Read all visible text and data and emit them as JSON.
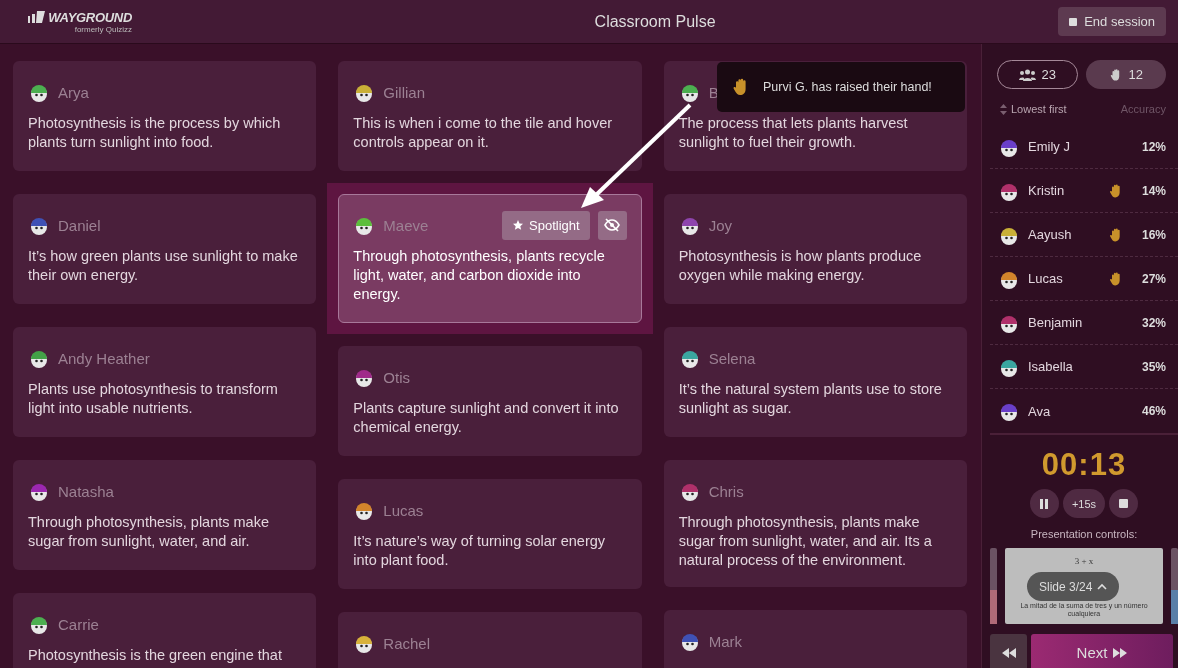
{
  "header": {
    "logo": "WAYGROUND",
    "logo_sub": "formerly Quizizz",
    "title": "Classroom Pulse",
    "end_button": "End session"
  },
  "columns": [
    [
      {
        "name": "Arya",
        "color": "#4caf50",
        "text": "Photosynthesis is the process by which plants turn sunlight into food.",
        "highlighted": false
      },
      {
        "name": "Daniel",
        "color": "#3f51b5",
        "text": "It’s how green plants use sunlight to make their own energy.",
        "highlighted": false
      },
      {
        "name": "Andy Heather",
        "color": "#43a047",
        "text": "Plants use photosynthesis to transform light into usable nutrients.",
        "highlighted": false
      },
      {
        "name": "Natasha",
        "color": "#9c27b0",
        "text": "Through photosynthesis, plants make sugar from sunlight, water, and air.",
        "highlighted": false
      },
      {
        "name": "Carrie",
        "color": "#4caf50",
        "text": "Photosynthesis is the green engine that",
        "highlighted": false
      }
    ],
    [
      {
        "name": "Gillian",
        "color": "#c9b037",
        "text": "This is when i come to the tile and hover controls appear on it.",
        "highlighted": false
      },
      {
        "name": "Maeve",
        "color": "#5cbf3c",
        "text": "Through photosynthesis, plants recycle light, water, and carbon dioxide into energy.",
        "highlighted": true,
        "action": "Spotlight"
      },
      {
        "name": "Otis",
        "color": "#a02a8a",
        "text": "Plants capture sunlight and convert it into chemical energy.",
        "highlighted": false
      },
      {
        "name": "Lucas",
        "color": "#d2842b",
        "text": "It’s nature’s way of turning solar energy into plant food.",
        "highlighted": false
      },
      {
        "name": "Rachel",
        "color": "#d8b23a",
        "text": "",
        "highlighted": false
      }
    ],
    [
      {
        "name": "B",
        "color": "#4caf50",
        "text": "The process that lets plants harvest sunlight to fuel their growth.",
        "highlighted": false
      },
      {
        "name": "Joy",
        "color": "#8e44ad",
        "text": "Photosynthesis is how plants produce oxygen while making energy.",
        "highlighted": false
      },
      {
        "name": "Selena",
        "color": "#3aa6a0",
        "text": "It’s the natural system plants use to store sunlight as sugar.",
        "highlighted": false
      },
      {
        "name": "Chris",
        "color": "#b0306a",
        "text": "Through photosynthesis, plants make sugar from sunlight, water, and air. Its a natural process of the environment.",
        "highlighted": false
      },
      {
        "name": "Mark",
        "color": "#3f51b5",
        "text": "",
        "highlighted": false
      }
    ]
  ],
  "toast": {
    "text": "Purvi G. has raised their hand!"
  },
  "sidebar": {
    "tabs": [
      {
        "kind": "people",
        "count": "23",
        "selected": true
      },
      {
        "kind": "hand",
        "count": "12",
        "selected": false
      }
    ],
    "sort": "Lowest first",
    "column": "Accuracy",
    "students": [
      {
        "name": "Emily J",
        "color": "#6a3fc9",
        "hand_raised": false,
        "accuracy": "12%"
      },
      {
        "name": "Kristin",
        "color": "#b0306a",
        "hand_raised": true,
        "accuracy": "14%"
      },
      {
        "name": "Aayush",
        "color": "#c9b037",
        "hand_raised": true,
        "accuracy": "16%"
      },
      {
        "name": "Lucas",
        "color": "#d2842b",
        "hand_raised": true,
        "accuracy": "27%"
      },
      {
        "name": "Benjamin",
        "color": "#b0306a",
        "hand_raised": false,
        "accuracy": "32%"
      },
      {
        "name": "Isabella",
        "color": "#3aa6a0",
        "hand_raised": false,
        "accuracy": "35%"
      },
      {
        "name": "Ava",
        "color": "#6a3fc9",
        "hand_raised": false,
        "accuracy": "46%"
      }
    ],
    "timer": "00:13",
    "add_time": "+15s",
    "presentation_label": "Presentation controls:",
    "slide": {
      "formula": "3 + x",
      "caption": "La mitad de la suma de tres y un número cualquiera",
      "badge": "Slide 3/24"
    },
    "next": "Next"
  }
}
